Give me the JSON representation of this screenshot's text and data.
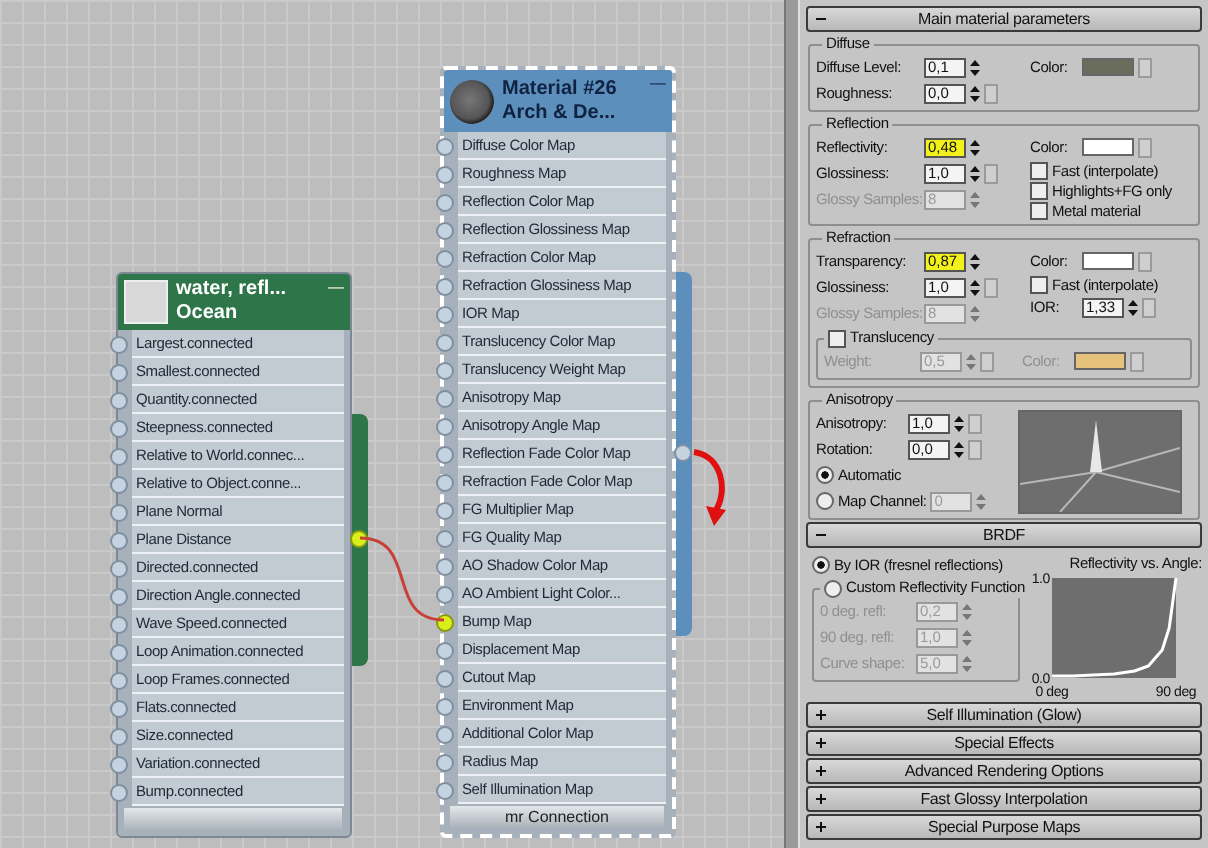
{
  "node_editor": {
    "nodes": [
      {
        "title": "water, refl...",
        "subtitle": "Ocean",
        "minimize_glyph": "—",
        "selected": false,
        "color": "#2e7549",
        "kind": "map",
        "output": {
          "connected": true
        },
        "rows": [
          {
            "label": "Largest.connected",
            "connected": false
          },
          {
            "label": "Smallest.connected",
            "connected": false
          },
          {
            "label": "Quantity.connected",
            "connected": false
          },
          {
            "label": "Steepness.connected",
            "connected": false
          },
          {
            "label": "Relative to World.connec...",
            "connected": false
          },
          {
            "label": "Relative to Object.conne...",
            "connected": false
          },
          {
            "label": "Plane Normal",
            "connected": false
          },
          {
            "label": "Plane Distance",
            "connected": false
          },
          {
            "label": "Directed.connected",
            "connected": false
          },
          {
            "label": "Direction Angle.connected",
            "connected": false
          },
          {
            "label": "Wave Speed.connected",
            "connected": false
          },
          {
            "label": "Loop Animation.connected",
            "connected": false
          },
          {
            "label": "Loop Frames.connected",
            "connected": false
          },
          {
            "label": "Flats.connected",
            "connected": false
          },
          {
            "label": "Size.connected",
            "connected": false
          },
          {
            "label": "Variation.connected",
            "connected": false
          },
          {
            "label": "Bump.connected",
            "connected": false
          }
        ]
      },
      {
        "title": "Material #26",
        "subtitle": "Arch & De...",
        "minimize_glyph": "—",
        "selected": true,
        "color": "#5d8fbd",
        "kind": "material",
        "output": {
          "connected": false
        },
        "footer": "mr Connection",
        "rows": [
          {
            "label": "Diffuse Color Map",
            "connected": false
          },
          {
            "label": "Roughness Map",
            "connected": false
          },
          {
            "label": "Reflection Color Map",
            "connected": false
          },
          {
            "label": "Reflection Glossiness Map",
            "connected": false
          },
          {
            "label": "Refraction Color Map",
            "connected": false
          },
          {
            "label": "Refraction Glossiness Map",
            "connected": false
          },
          {
            "label": "IOR Map",
            "connected": false
          },
          {
            "label": "Translucency Color Map",
            "connected": false
          },
          {
            "label": "Translucency Weight Map",
            "connected": false
          },
          {
            "label": "Anisotropy Map",
            "connected": false
          },
          {
            "label": "Anisotropy Angle Map",
            "connected": false
          },
          {
            "label": "Reflection Fade Color Map",
            "connected": false
          },
          {
            "label": "Refraction Fade Color Map",
            "connected": false
          },
          {
            "label": "FG Multiplier Map",
            "connected": false
          },
          {
            "label": "FG Quality Map",
            "connected": false
          },
          {
            "label": "AO Shadow Color Map",
            "connected": false
          },
          {
            "label": "AO Ambient Light Color...",
            "connected": false
          },
          {
            "label": "Bump Map",
            "connected": true
          },
          {
            "label": "Displacement Map",
            "connected": false
          },
          {
            "label": "Cutout Map",
            "connected": false
          },
          {
            "label": "Environment Map",
            "connected": false
          },
          {
            "label": "Additional Color Map",
            "connected": false
          },
          {
            "label": "Radius Map",
            "connected": false
          },
          {
            "label": "Self Illumination Map",
            "connected": false
          }
        ]
      }
    ]
  },
  "panel": {
    "rollouts": [
      {
        "title": "Main material parameters",
        "expanded": true,
        "groups": [
          {
            "title": "Diffuse",
            "left": [
              {
                "kind": "spinner",
                "label": "Diffuse Level:",
                "value": "0,1",
                "disabled": false,
                "highlighted": false,
                "map_button": false
              },
              {
                "kind": "spinner",
                "label": "Roughness:",
                "value": "0,0",
                "disabled": false,
                "highlighted": false,
                "map_button": true
              }
            ],
            "right": [
              {
                "kind": "color",
                "label": "Color:",
                "color": "#6a6c5c",
                "disabled": false
              }
            ]
          },
          {
            "title": "Reflection",
            "left": [
              {
                "kind": "spinner",
                "label": "Reflectivity:",
                "value": "0,48",
                "disabled": false,
                "highlighted": true,
                "map_button": false
              },
              {
                "kind": "spinner",
                "label": "Glossiness:",
                "value": "1,0",
                "disabled": false,
                "highlighted": false,
                "map_button": true
              },
              {
                "kind": "spinner",
                "label": "Glossy Samples:",
                "value": "8",
                "disabled": true,
                "highlighted": false,
                "map_button": false
              }
            ],
            "right": [
              {
                "kind": "color",
                "label": "Color:",
                "color": "#ffffff",
                "disabled": false
              },
              {
                "kind": "checkbox",
                "label": "Fast (interpolate)",
                "checked": false
              },
              {
                "kind": "checkbox",
                "label": "Highlights+FG only",
                "checked": false
              },
              {
                "kind": "checkbox",
                "label": "Metal material",
                "checked": false
              }
            ]
          },
          {
            "title": "Refraction",
            "left": [
              {
                "kind": "spinner",
                "label": "Transparency:",
                "value": "0,87",
                "disabled": false,
                "highlighted": true,
                "map_button": false
              },
              {
                "kind": "spinner",
                "label": "Glossiness:",
                "value": "1,0",
                "disabled": false,
                "highlighted": false,
                "map_button": true
              },
              {
                "kind": "spinner",
                "label": "Glossy Samples:",
                "value": "8",
                "disabled": true,
                "highlighted": false,
                "map_button": false
              }
            ],
            "right": [
              {
                "kind": "color",
                "label": "Color:",
                "color": "#ffffff",
                "disabled": false
              },
              {
                "kind": "checkbox",
                "label": "Fast (interpolate)",
                "checked": false
              },
              {
                "kind": "spinner",
                "label": "IOR:",
                "value": "1,33",
                "disabled": false,
                "highlighted": false,
                "map_button": true
              }
            ],
            "subgroup": {
              "label": "Translucency",
              "checked": false,
              "left": [
                {
                  "kind": "spinner",
                  "label": "Weight:",
                  "value": "0,5",
                  "disabled": true,
                  "highlighted": false,
                  "map_button": true
                }
              ],
              "right": [
                {
                  "kind": "color",
                  "label": "Color:",
                  "color": "#e6c27c",
                  "disabled": true
                }
              ]
            }
          },
          {
            "title": "Anisotropy",
            "preview": true,
            "left": [
              {
                "kind": "spinner",
                "label": "Anisotropy:",
                "value": "1,0",
                "disabled": false,
                "highlighted": false,
                "map_button": true
              },
              {
                "kind": "spinner",
                "label": "Rotation:",
                "value": "0,0",
                "disabled": false,
                "highlighted": false,
                "map_button": true
              },
              {
                "kind": "radio",
                "label": "Automatic",
                "selected": true
              },
              {
                "kind": "radio_spinner",
                "label": "Map Channel:",
                "selected": false,
                "value": "0",
                "disabled": true
              }
            ]
          }
        ]
      },
      {
        "title": "BRDF",
        "expanded": true,
        "brdf": {
          "options": [
            {
              "label": "By IOR (fresnel reflections)",
              "selected": true
            },
            {
              "label": "Custom Reflectivity Function",
              "selected": false
            }
          ],
          "custom": [
            {
              "kind": "spinner",
              "label": "0 deg. refl:",
              "value": "0,2",
              "disabled": true,
              "highlighted": false,
              "map_button": false
            },
            {
              "kind": "spinner",
              "label": "90 deg. refl:",
              "value": "1,0",
              "disabled": true,
              "highlighted": false,
              "map_button": false
            },
            {
              "kind": "spinner",
              "label": "Curve shape:",
              "value": "5,0",
              "disabled": true,
              "highlighted": false,
              "map_button": false
            }
          ],
          "chart_data": {
            "type": "line",
            "title": "Reflectivity vs. Angle:",
            "x": [
              0,
              15,
              30,
              45,
              60,
              70,
              80,
              85,
              90
            ],
            "series": [
              {
                "color": "#ffffff",
                "values": [
                  0.02,
                  0.02,
                  0.03,
                  0.04,
                  0.07,
                  0.12,
                  0.28,
                  0.5,
                  1.0
                ]
              }
            ],
            "xlim": [
              0,
              90
            ],
            "ylim": [
              0,
              1
            ],
            "xticks": [
              {
                "value": 0,
                "label": "0 deg"
              },
              {
                "value": 90,
                "label": "90 deg"
              }
            ],
            "yticks": [
              {
                "value": 0,
                "label": "0.0"
              },
              {
                "value": 1,
                "label": "1.0"
              }
            ]
          }
        }
      },
      {
        "title": "Self Illumination (Glow)",
        "expanded": false
      },
      {
        "title": "Special Effects",
        "expanded": false
      },
      {
        "title": "Advanced Rendering Options",
        "expanded": false
      },
      {
        "title": "Fast Glossy Interpolation",
        "expanded": false
      },
      {
        "title": "Special Purpose Maps",
        "expanded": false
      }
    ]
  }
}
